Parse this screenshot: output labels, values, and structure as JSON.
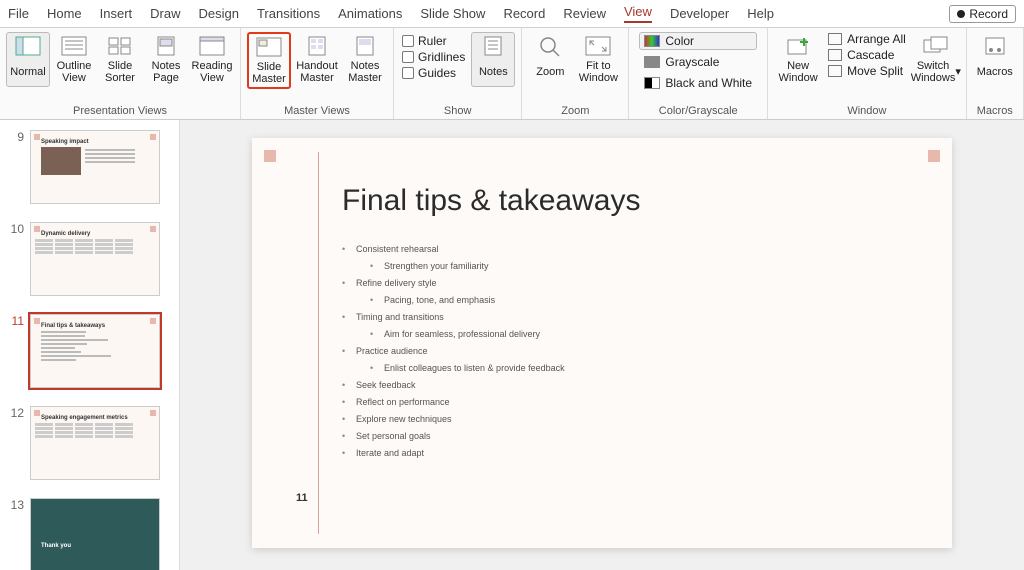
{
  "menu": {
    "items": [
      "File",
      "Home",
      "Insert",
      "Draw",
      "Design",
      "Transitions",
      "Animations",
      "Slide Show",
      "Record",
      "Review",
      "View",
      "Developer",
      "Help"
    ],
    "active": "View",
    "record_button": "Record"
  },
  "ribbon": {
    "groups": {
      "presentation_views": {
        "label": "Presentation Views",
        "buttons": [
          {
            "label": "Normal",
            "icon": "normal-view-icon",
            "selected": true
          },
          {
            "label": "Outline View",
            "icon": "outline-view-icon"
          },
          {
            "label": "Slide Sorter",
            "icon": "slide-sorter-icon"
          },
          {
            "label": "Notes Page",
            "icon": "notes-page-icon"
          },
          {
            "label": "Reading View",
            "icon": "reading-view-icon"
          }
        ]
      },
      "master_views": {
        "label": "Master Views",
        "buttons": [
          {
            "label": "Slide Master",
            "icon": "slide-master-icon",
            "highlight": true
          },
          {
            "label": "Handout Master",
            "icon": "handout-master-icon"
          },
          {
            "label": "Notes Master",
            "icon": "notes-master-icon"
          }
        ]
      },
      "show": {
        "label": "Show",
        "checks": [
          {
            "label": "Ruler"
          },
          {
            "label": "Gridlines"
          },
          {
            "label": "Guides"
          }
        ],
        "notes_button": "Notes"
      },
      "zoom": {
        "label": "Zoom",
        "zoom_button": "Zoom",
        "fit_button": "Fit to Window"
      },
      "color": {
        "label": "Color/Grayscale",
        "options": [
          {
            "label": "Color",
            "swatch": "linear-gradient(90deg,#c33,#3c3,#33c)",
            "selected": true
          },
          {
            "label": "Grayscale",
            "swatch": "#888"
          },
          {
            "label": "Black and White",
            "swatch": "#000"
          }
        ]
      },
      "window": {
        "label": "Window",
        "new_window": "New Window",
        "items": [
          {
            "label": "Arrange All",
            "icon": "arrange-all-icon"
          },
          {
            "label": "Cascade",
            "icon": "cascade-icon"
          },
          {
            "label": "Move Split",
            "icon": "move-split-icon"
          }
        ],
        "switch": "Switch Windows"
      },
      "macros": {
        "label": "Macros",
        "button": "Macros"
      }
    }
  },
  "thumbnails": [
    {
      "num": "9",
      "title": "Speaking impact",
      "variant": "image"
    },
    {
      "num": "10",
      "title": "Dynamic delivery",
      "variant": "table"
    },
    {
      "num": "11",
      "title": "Final tips & takeaways",
      "variant": "list",
      "active": true
    },
    {
      "num": "12",
      "title": "Speaking engagement metrics",
      "variant": "table"
    },
    {
      "num": "13",
      "title": "Thank you",
      "variant": "dark"
    }
  ],
  "slide": {
    "title": "Final tips & takeaways",
    "bullets": [
      {
        "text": "Consistent rehearsal"
      },
      {
        "text": "Strengthen your familiarity",
        "sub": true
      },
      {
        "text": "Refine delivery style"
      },
      {
        "text": "Pacing, tone, and emphasis",
        "sub": true
      },
      {
        "text": "Timing and transitions"
      },
      {
        "text": "Aim for seamless, professional delivery",
        "sub": true
      },
      {
        "text": "Practice audience"
      },
      {
        "text": "Enlist colleagues to listen & provide feedback",
        "sub": true
      },
      {
        "text": "Seek feedback"
      },
      {
        "text": "Reflect on performance"
      },
      {
        "text": "Explore new techniques"
      },
      {
        "text": "Set personal goals"
      },
      {
        "text": "Iterate and adapt"
      }
    ],
    "page_number": "11"
  }
}
